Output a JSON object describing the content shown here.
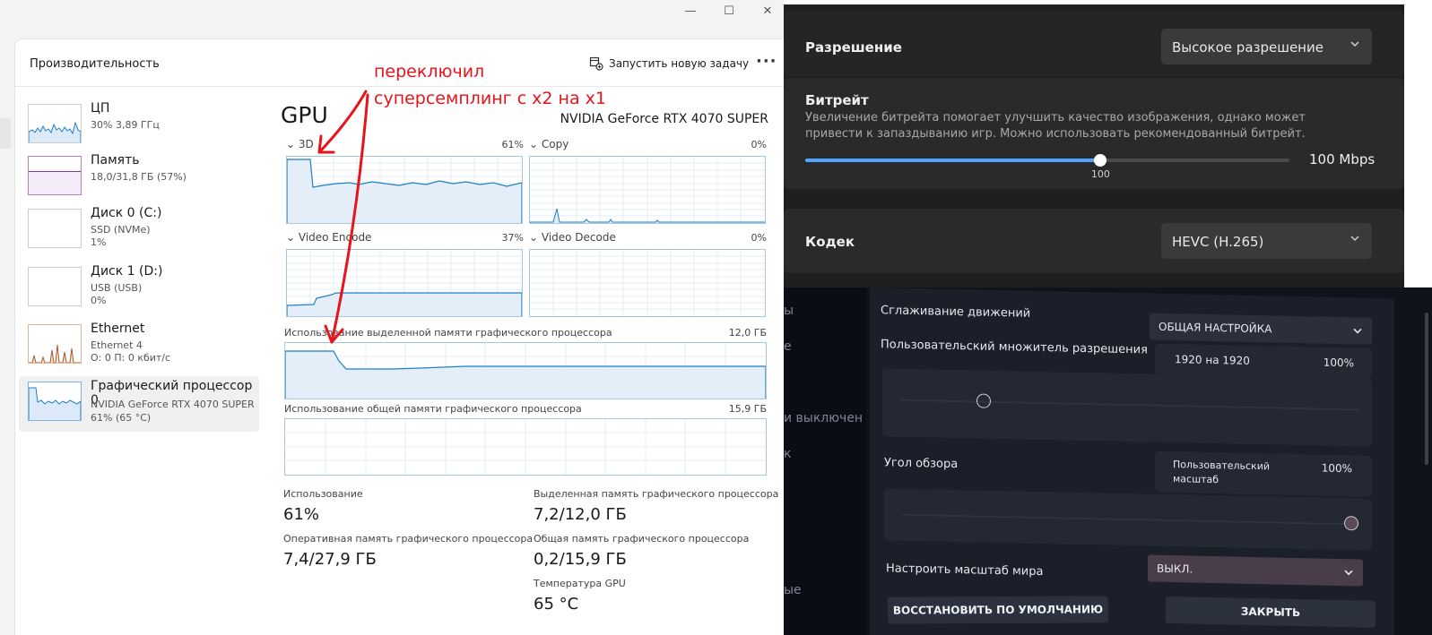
{
  "task_manager": {
    "window_buttons": {
      "minimize": "—",
      "maximize": "☐",
      "close": "✕"
    },
    "title": "Производительность",
    "run_task": "Запустить новую задачу",
    "more": "···",
    "devices": [
      {
        "name": "ЦП",
        "line1": "30% 3,89 ГГц",
        "line2": ""
      },
      {
        "name": "Память",
        "line1": "18,0/31,8 ГБ (57%)",
        "line2": ""
      },
      {
        "name": "Диск 0 (C:)",
        "line1": "SSD (NVMe)",
        "line2": "1%"
      },
      {
        "name": "Диск 1 (D:)",
        "line1": "USB (USB)",
        "line2": "0%"
      },
      {
        "name": "Ethernet",
        "line1": "Ethernet 4",
        "line2": "О: 0 П: 0 кбит/с"
      },
      {
        "name": "Графический процессор 0",
        "line1": "NVIDIA GeForce RTX 4070 SUPER",
        "line2": "61% (65 °C)"
      }
    ],
    "gpu": {
      "title": "GPU",
      "model": "NVIDIA GeForce RTX 4070 SUPER",
      "engines": [
        {
          "label": "3D",
          "pct": "61%"
        },
        {
          "label": "Copy",
          "pct": "0%"
        },
        {
          "label": "Video Encode",
          "pct": "37%"
        },
        {
          "label": "Video Decode",
          "pct": "0%"
        }
      ],
      "dedicated_label": "Использование выделенной памяти графического процессора",
      "dedicated_max": "12,0 ГБ",
      "shared_label": "Использование общей памяти графического процессора",
      "shared_max": "15,9 ГБ",
      "stats": {
        "usage_label": "Использование",
        "usage_value": "61%",
        "dedicated_label": "Выделенная память графического процессора",
        "dedicated_value": "7,2/12,0 ГБ",
        "gpu_ram_label": "Оперативная память графического процессора",
        "gpu_ram_value": "7,4/27,9 ГБ",
        "shared_label": "Общая память графического процессора",
        "shared_value": "0,2/15,9 ГБ",
        "temp_label": "Температура GPU",
        "temp_value": "65 °C"
      }
    },
    "annotation": {
      "line1": "переключил",
      "line2": "суперсемплинг с x2 на x1",
      "color": "#e8141b"
    }
  },
  "stream_settings": {
    "resolution_label": "Разрешение",
    "resolution_value": "Высокое разрешение",
    "bitrate_label": "Битрейт",
    "bitrate_desc1": "Увеличение битрейта помогает улучшить качество изображения, однако может",
    "bitrate_desc2": "привести к запаздыванию игр. Можно использовать рекомендованный битрейт.",
    "bitrate_value": "100 Mbps",
    "bitrate_slider_label": "100",
    "bitrate_fraction": 0.61,
    "codec_label": "Кодек",
    "codec_value": "HEVC (H.265)",
    "accent": "#4ea4ff"
  },
  "vr_menu": {
    "side_items": [
      "ы",
      "е",
      "и выключен",
      "к",
      "ые"
    ],
    "motion_smoothing_label": "Сглаживание движений",
    "motion_smoothing_value": "ОБЩАЯ НАСТРОЙКА",
    "res_multiplier_label": "Пользовательский множитель разрешения",
    "res_value": "1920 на 1920",
    "res_pct": "100%",
    "res_fraction": 0.18,
    "fov_label": "Угол обзора",
    "fov_value_line1": "Пользовательский",
    "fov_value_line2": "масштаб",
    "fov_pct": "100%",
    "fov_fraction": 1.0,
    "world_scale_label": "Настроить масштаб мира",
    "world_scale_value": "ВЫКЛ.",
    "restore_button": "ВОССТАНОВИТЬ ПО УМОЛЧАНИЮ",
    "close_button": "ЗАКРЫТЬ"
  }
}
